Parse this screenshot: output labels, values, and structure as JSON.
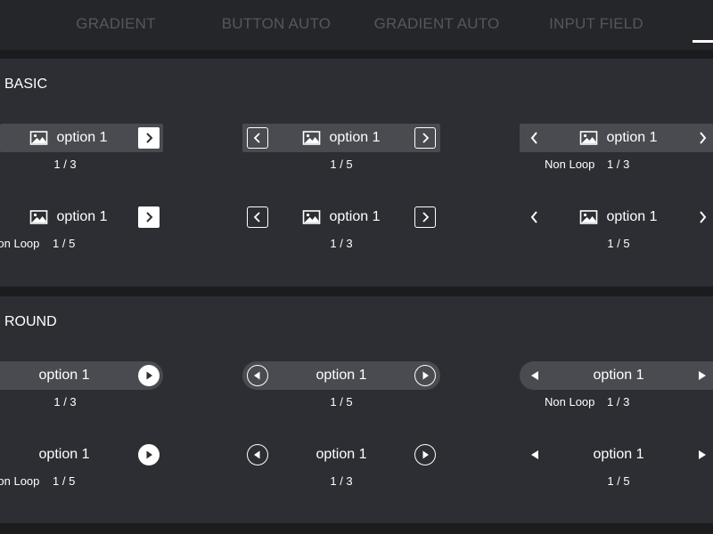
{
  "tabs": [
    {
      "label": "GRADIENT"
    },
    {
      "label": "BUTTON AUTO"
    },
    {
      "label": "GRADIENT AUTO"
    },
    {
      "label": "INPUT FIELD"
    }
  ],
  "sections": {
    "basic": {
      "title": "BASIC",
      "row1": {
        "col1": {
          "option": "option 1",
          "counter": "1 / 3"
        },
        "col2": {
          "option": "option 1",
          "counter": "1 / 5"
        },
        "col3": {
          "option": "option 1",
          "loop_label": "Non Loop",
          "counter": "1 / 3"
        }
      },
      "row2": {
        "col1": {
          "option": "option 1",
          "loop_label": "Non Loop",
          "counter": "1 / 5"
        },
        "col2": {
          "option": "option 1",
          "counter": "1 / 3"
        },
        "col3": {
          "option": "option 1",
          "counter": "1 / 5"
        }
      }
    },
    "round": {
      "title": "ROUND",
      "row1": {
        "col1": {
          "option": "option 1",
          "counter": "1 / 3"
        },
        "col2": {
          "option": "option 1",
          "counter": "1 / 5"
        },
        "col3": {
          "option": "option 1",
          "loop_label": "Non Loop",
          "counter": "1 / 3"
        }
      },
      "row2": {
        "col1": {
          "option": "option 1",
          "loop_label": "Non Loop",
          "counter": "1 / 5"
        },
        "col2": {
          "option": "option 1",
          "counter": "1 / 3"
        },
        "col3": {
          "option": "option 1",
          "counter": "1 / 5"
        }
      }
    }
  },
  "icons": {
    "option_icon": "image-icon",
    "prev": "chevron-left-icon",
    "next": "chevron-right-icon",
    "prev_round": "triangle-left-icon",
    "next_round": "triangle-right-icon"
  },
  "colors": {
    "background": "#1b1c1e",
    "topbar": "#25262a",
    "panel": "#2d2e33",
    "selector_bg": "#4a4b50",
    "tab_text": "#55575c",
    "text": "#ffffff"
  }
}
